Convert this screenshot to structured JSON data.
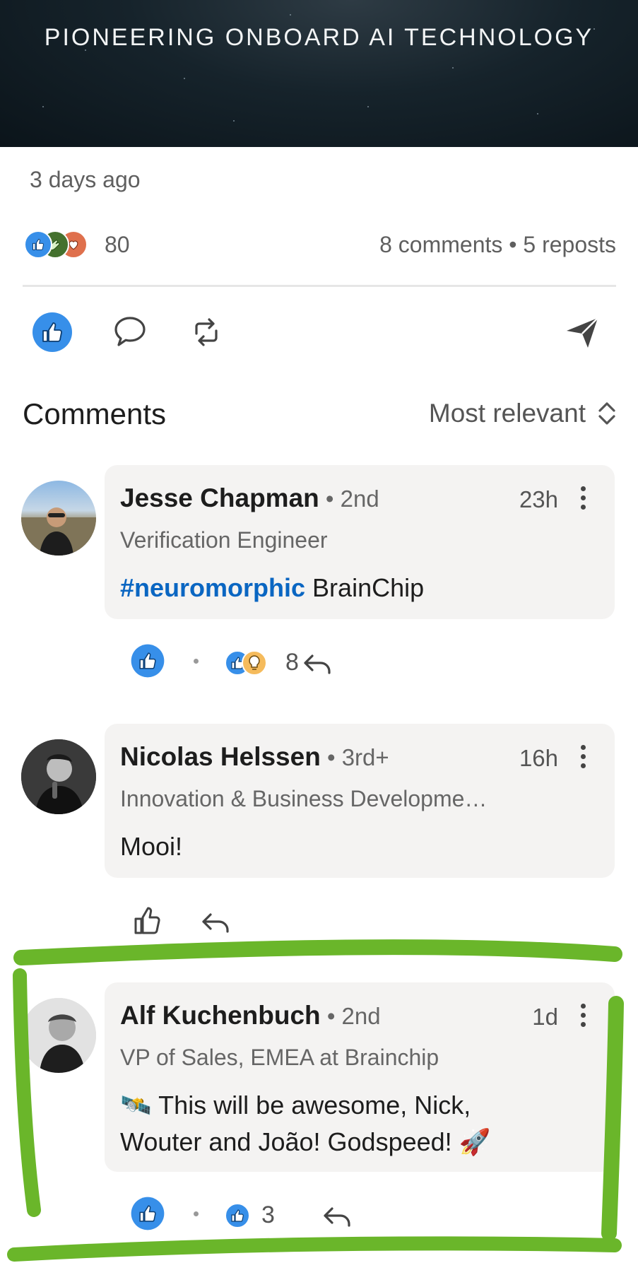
{
  "post": {
    "banner_title": "PIONEERING ONBOARD AI TECHNOLOGY",
    "posted": "3 days ago",
    "reaction_count": "80",
    "stats": "8 comments • 5 reposts",
    "reaction_icons": [
      "like-icon",
      "celebrate-icon",
      "love-icon"
    ]
  },
  "actions": {
    "like": "like-icon",
    "comment": "comment-icon",
    "repost": "repost-icon",
    "send": "send-icon"
  },
  "comments_section": {
    "title": "Comments",
    "sort_label": "Most relevant"
  },
  "comments": [
    {
      "name": "Jesse Chapman",
      "degree": " • 2nd",
      "time": "23h",
      "headline": "Verification Engineer",
      "hashtag": "#neuromorphic",
      "text": " BrainChip",
      "reaction_count": "8",
      "liked": true
    },
    {
      "name": "Nicolas Helssen",
      "degree": " • 3rd+",
      "time": "16h",
      "headline": "Innovation & Business Developme…",
      "text": "Mooi!",
      "liked": false
    },
    {
      "name": "Alf Kuchenbuch",
      "degree": " • 2nd",
      "time": "1d",
      "headline": "VP of Sales, EMEA at Brainchip",
      "text_line1": "🛰️ This will be awesome, Nick,",
      "text_line2": "Wouter and   João! Godspeed! 🚀",
      "reaction_count": "3",
      "liked": true
    }
  ],
  "colors": {
    "accent_blue": "#0a66c2",
    "highlight_green": "#6ab62a",
    "bubble": "#f4f3f2"
  }
}
